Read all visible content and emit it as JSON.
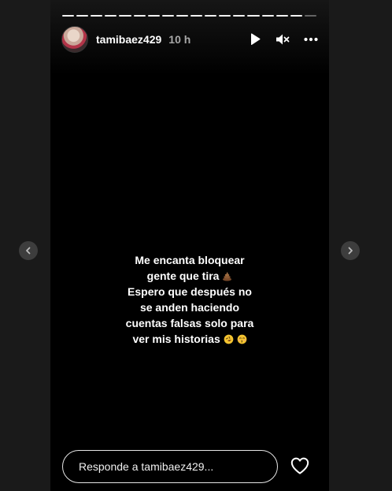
{
  "story": {
    "username": "tamibaez429",
    "time": "10 h",
    "progress_segments": 18,
    "progress_viewed": 17,
    "message_lines": [
      "Me encanta bloquear",
      "gente que tira",
      "Espero que después no",
      "se anden haciendo",
      "cuentas falsas solo para",
      "ver mis historias"
    ],
    "message_emojis": [
      "poop-emoji",
      "rofl-emoji",
      "kissing-emoji"
    ],
    "reply_placeholder": "Responde a tamibaez429..."
  },
  "icons": {
    "play": "play-icon",
    "mute": "speaker-muted-icon",
    "more": "more-options-icon",
    "heart": "heart-icon",
    "prev": "chevron-left-icon",
    "next": "chevron-right-icon"
  },
  "colors": {
    "background": "#1a1a1a",
    "story_bg": "#000000",
    "text": "#ffffff",
    "muted_text": "#a8a8a8"
  }
}
